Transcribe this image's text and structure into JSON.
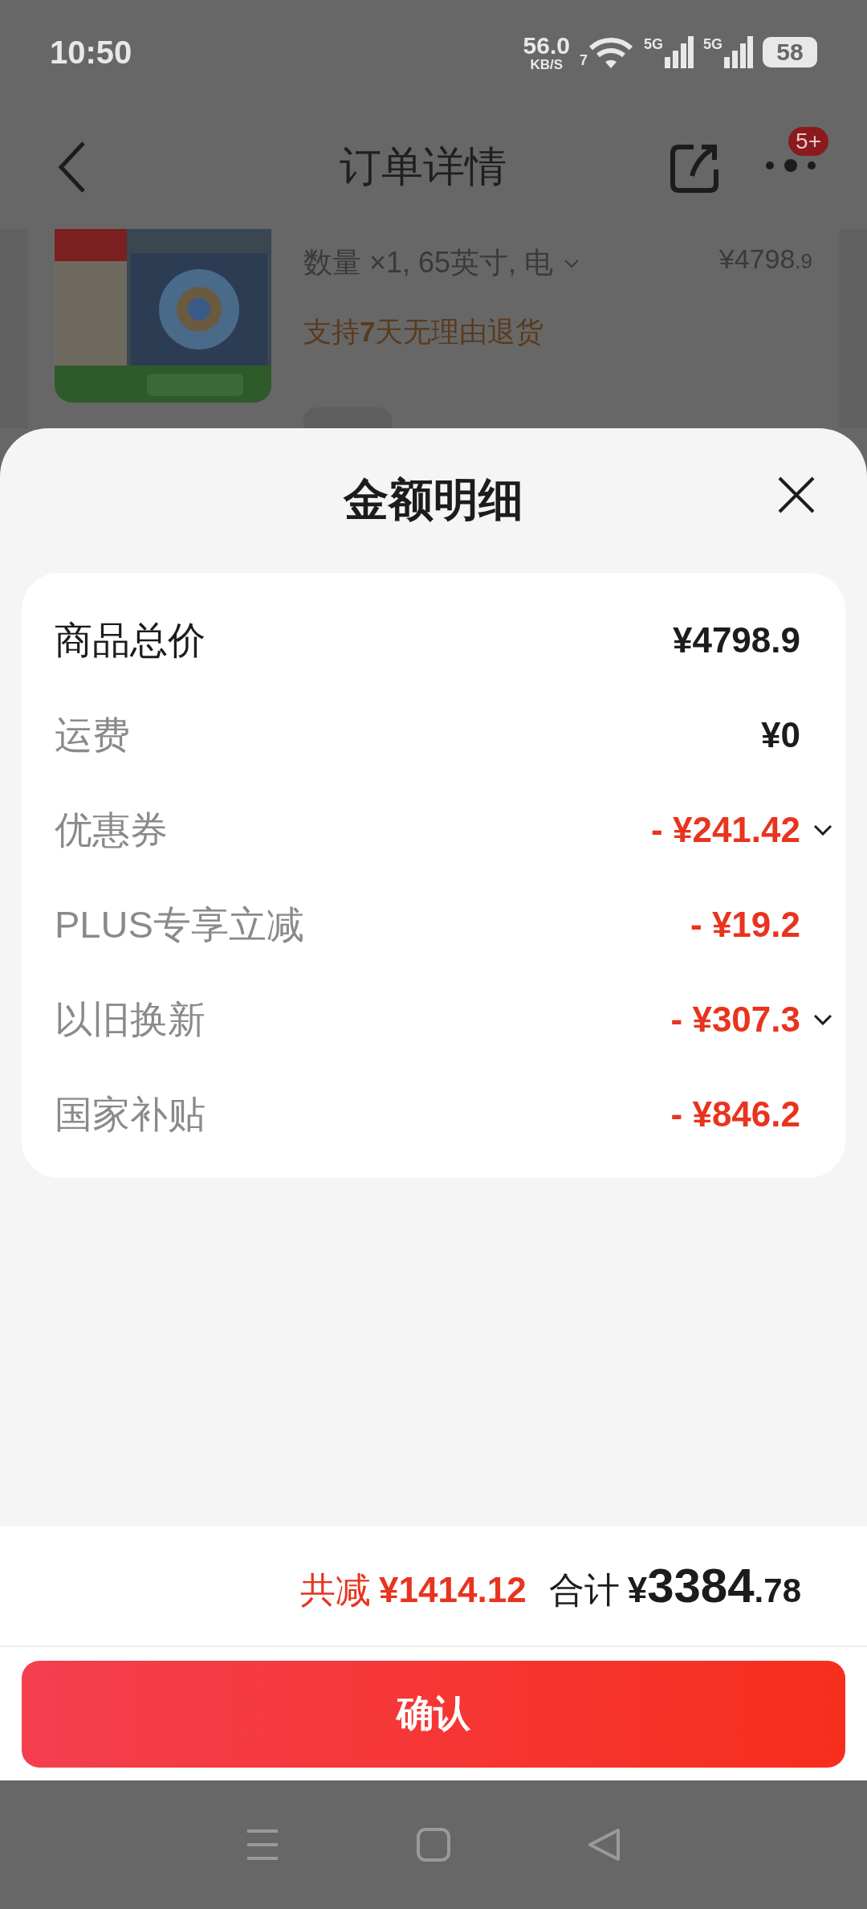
{
  "status_bar": {
    "time": "10:50",
    "net_speed": "56.0",
    "net_unit": "KB/S",
    "wifi_badge": "7",
    "sims": [
      "5G",
      "5G"
    ],
    "battery": "58"
  },
  "header": {
    "title": "订单详情",
    "badge": "5+"
  },
  "order_item": {
    "kind": "picture",
    "quantity": "数量 ×1, 65英寸, 电",
    "price_main": "¥4798",
    "price_decimal": ".9",
    "return_policy": "支持**7**天无理由退货"
  },
  "sheet": {
    "title": "金额明细",
    "rows": [
      {
        "label": "商品总价",
        "value": "¥4798.9",
        "kind": "total",
        "expandable": false
      },
      {
        "label": "运费",
        "value": "¥0",
        "kind": "fee",
        "expandable": false
      },
      {
        "label": "优惠券",
        "value": "- ¥241.42",
        "kind": "discount",
        "expandable": true
      },
      {
        "label": "PLUS专享立减",
        "value": "- ¥19.2",
        "kind": "discount",
        "expandable": false
      },
      {
        "label": "以旧换新",
        "value": "- ¥307.3",
        "kind": "discount",
        "expandable": true
      },
      {
        "label": "国家补贴",
        "value": "- ¥846.2",
        "kind": "discount",
        "expandable": false
      }
    ]
  },
  "footer": {
    "reduction_label": "共减",
    "reduction": "¥1414.12",
    "total_label": "合计",
    "total_currency": "¥",
    "total_integer": "3384",
    "total_decimal": ".78",
    "confirm_button": "确认"
  }
}
